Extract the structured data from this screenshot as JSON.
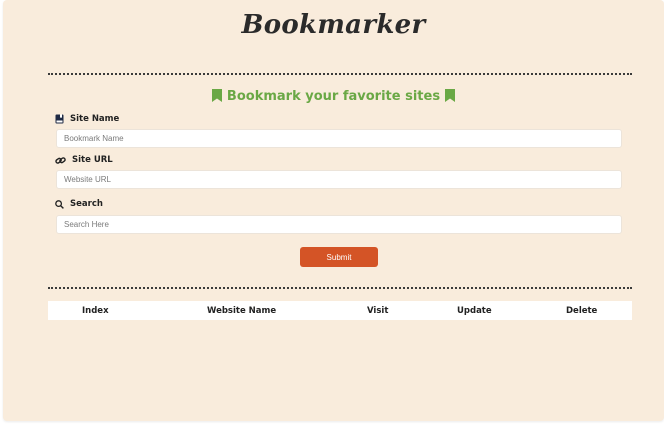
{
  "app": {
    "logo_text": "Bookmarker",
    "tagline": "Bookmark your favorite sites"
  },
  "form": {
    "site_name": {
      "label": "Site Name",
      "placeholder": "Bookmark Name",
      "icon": "bookmark-book-icon"
    },
    "site_url": {
      "label": "Site URL",
      "placeholder": "Website URL",
      "icon": "link-icon"
    },
    "search": {
      "label": "Search",
      "placeholder": "Search Here",
      "icon": "search-icon"
    },
    "submit_label": "Submit"
  },
  "table": {
    "headers": [
      "Index",
      "Website Name",
      "Visit",
      "Update",
      "Delete"
    ],
    "rows": []
  },
  "colors": {
    "background": "#f9ecdc",
    "tagline_green": "#6aa845",
    "submit_orange": "#d45426",
    "logo_highlight": "#f7c46c"
  }
}
